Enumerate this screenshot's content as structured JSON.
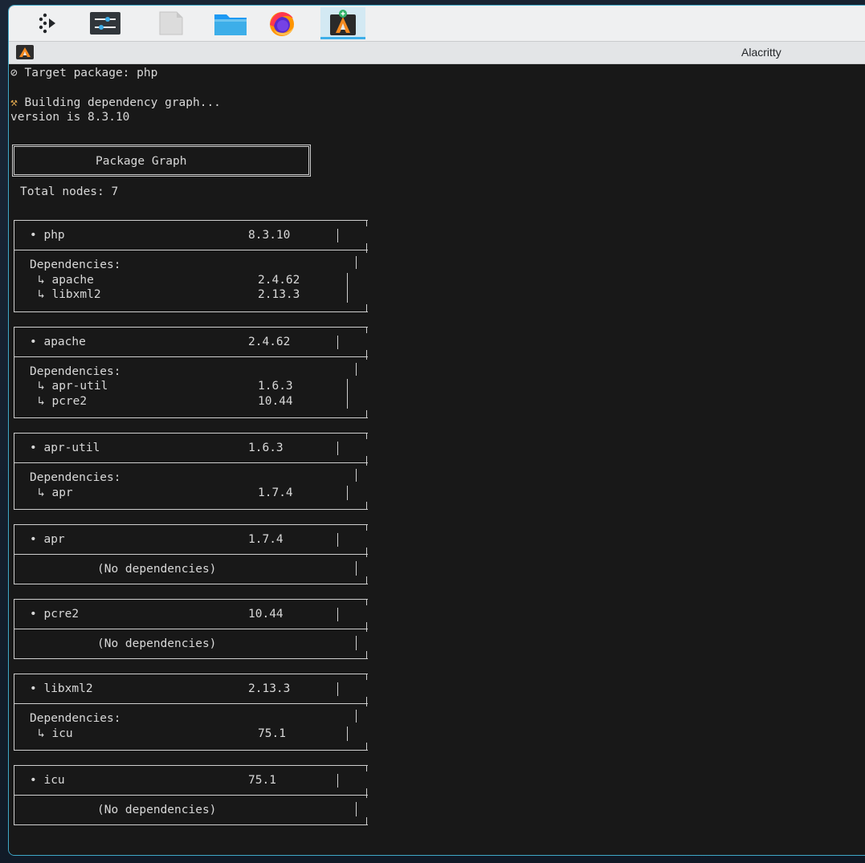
{
  "window": {
    "title": "Alacritty"
  },
  "taskbar": {
    "items": [
      {
        "name": "app-launcher",
        "icon": "dots-launcher-icon"
      },
      {
        "name": "system-settings",
        "icon": "sliders-icon"
      },
      {
        "name": "text-editor",
        "icon": "blank-document-icon"
      },
      {
        "name": "file-manager",
        "icon": "folder-icon"
      },
      {
        "name": "firefox",
        "icon": "firefox-icon"
      },
      {
        "name": "alacritty",
        "icon": "alacritty-icon",
        "active": true
      }
    ]
  },
  "terminal": {
    "target_line": "Target package: php",
    "building_line": "Building dependency graph...",
    "version_line": "version is 8.3.10",
    "graph_title": "Package Graph",
    "total_nodes": "Total nodes: 7",
    "dependencies_label": "Dependencies:",
    "no_deps_label": "(No dependencies)",
    "packages": [
      {
        "name": "php",
        "version": "8.3.10",
        "deps": [
          {
            "name": "apache",
            "version": "2.4.62"
          },
          {
            "name": "libxml2",
            "version": "2.13.3"
          }
        ]
      },
      {
        "name": "apache",
        "version": "2.4.62",
        "deps": [
          {
            "name": "apr-util",
            "version": "1.6.3"
          },
          {
            "name": "pcre2",
            "version": "10.44"
          }
        ]
      },
      {
        "name": "apr-util",
        "version": "1.6.3",
        "deps": [
          {
            "name": "apr",
            "version": "1.7.4"
          }
        ]
      },
      {
        "name": "apr",
        "version": "1.7.4",
        "deps": []
      },
      {
        "name": "pcre2",
        "version": "10.44",
        "deps": []
      },
      {
        "name": "libxml2",
        "version": "2.13.3",
        "deps": [
          {
            "name": "icu",
            "version": "75.1"
          }
        ]
      },
      {
        "name": "icu",
        "version": "75.1",
        "deps": []
      }
    ]
  },
  "colors": {
    "terminal_bg": "#181818",
    "terminal_fg": "#d8d8d8",
    "accent": "#3daee9"
  }
}
